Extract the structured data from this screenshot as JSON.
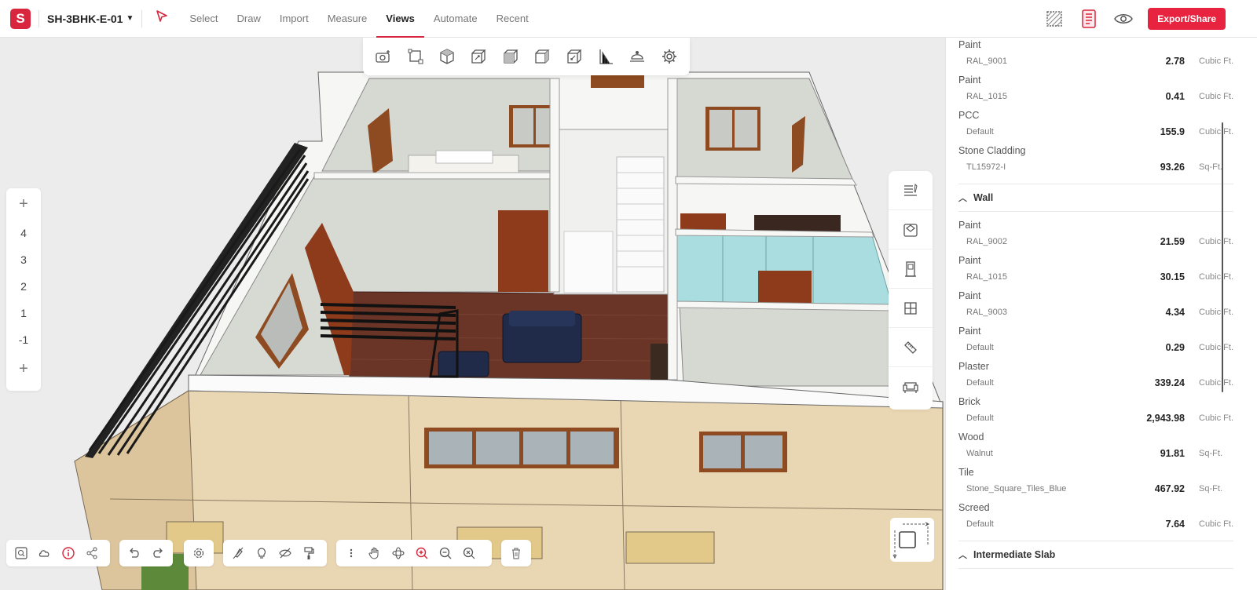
{
  "app": {
    "logo_letter": "S",
    "project_name": "SH-3BHK-E-01",
    "accent": "#d7263d"
  },
  "nav": {
    "tabs": [
      {
        "label": "Select"
      },
      {
        "label": "Draw"
      },
      {
        "label": "Import"
      },
      {
        "label": "Measure"
      },
      {
        "label": "Views",
        "active": true
      },
      {
        "label": "Automate"
      },
      {
        "label": "Recent"
      }
    ]
  },
  "header_right": {
    "export_label": "Export/Share"
  },
  "levels": {
    "items": [
      "4",
      "3",
      "2",
      "1",
      "-1"
    ]
  },
  "panel": {
    "top_items": [
      {
        "name": "Paint",
        "sub": "RAL_9001",
        "value": "2.78",
        "unit": "Cubic Ft."
      },
      {
        "name": "Paint",
        "sub": "RAL_1015",
        "value": "0.41",
        "unit": "Cubic Ft."
      },
      {
        "name": "PCC",
        "sub": "Default",
        "value": "155.9",
        "unit": "Cubic Ft."
      },
      {
        "name": "Stone Cladding",
        "sub": "TL15972-I",
        "value": "93.26",
        "unit": "Sq-Ft."
      }
    ],
    "wall_group": {
      "label": "Wall",
      "items": [
        {
          "name": "Paint",
          "sub": "RAL_9002",
          "value": "21.59",
          "unit": "Cubic Ft."
        },
        {
          "name": "Paint",
          "sub": "RAL_1015",
          "value": "30.15",
          "unit": "Cubic Ft."
        },
        {
          "name": "Paint",
          "sub": "RAL_9003",
          "value": "4.34",
          "unit": "Cubic Ft."
        },
        {
          "name": "Paint",
          "sub": "Default",
          "value": "0.29",
          "unit": "Cubic Ft."
        },
        {
          "name": "Plaster",
          "sub": "Default",
          "value": "339.24",
          "unit": "Cubic Ft."
        },
        {
          "name": "Brick",
          "sub": "Default",
          "value": "2,943.98",
          "unit": "Cubic Ft."
        },
        {
          "name": "Wood",
          "sub": "Walnut",
          "value": "91.81",
          "unit": "Sq-Ft."
        },
        {
          "name": "Tile",
          "sub": "Stone_Square_Tiles_Blue",
          "value": "467.92",
          "unit": "Sq-Ft."
        },
        {
          "name": "Screed",
          "sub": "Default",
          "value": "7.64",
          "unit": "Cubic Ft."
        }
      ]
    },
    "slab_group": {
      "label": "Intermediate Slab"
    }
  }
}
